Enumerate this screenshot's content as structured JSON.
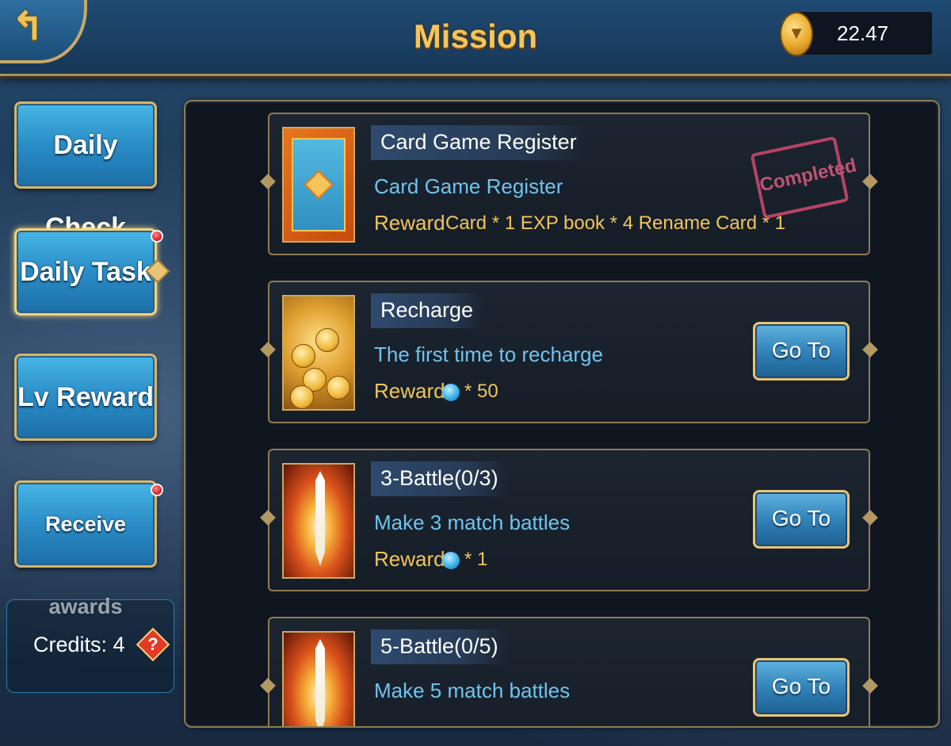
{
  "header": {
    "title": "Mission",
    "back_icon": "back-arrow-icon",
    "coin_icon": "gold-coin-icon",
    "coin_value": "22.47"
  },
  "sidebar": {
    "items": [
      {
        "label": "Daily Check",
        "active": false,
        "badge": false
      },
      {
        "label": "Daily Task",
        "active": true,
        "badge": true
      },
      {
        "label": "Lv Reward",
        "active": false,
        "badge": false
      },
      {
        "label": "Receive awards",
        "active": false,
        "badge": true
      }
    ],
    "credits_label": "Credits: 4",
    "help_icon": "?"
  },
  "missions": [
    {
      "name": "Card Game Register",
      "description": "Card Game Register",
      "reward_label": "Reward",
      "reward_text": "Card * 1 EXP book * 4 Rename Card * 1",
      "status": "Completed",
      "thumbnail": "card-back"
    },
    {
      "name": "Recharge",
      "description": "The first time to recharge",
      "reward_label": "Reward",
      "reward_gem_count": "* 50",
      "button_label": "Go To",
      "thumbnail": "gold-coins"
    },
    {
      "name": "3-Battle(0/3)",
      "description": "Make 3 match battles",
      "reward_label": "Reward",
      "reward_gem_count": "* 1",
      "button_label": "Go To",
      "thumbnail": "fire-sword"
    },
    {
      "name": "5-Battle(0/5)",
      "description": "Make 5 match battles",
      "button_label": "Go To",
      "thumbnail": "fire-sword"
    }
  ]
}
